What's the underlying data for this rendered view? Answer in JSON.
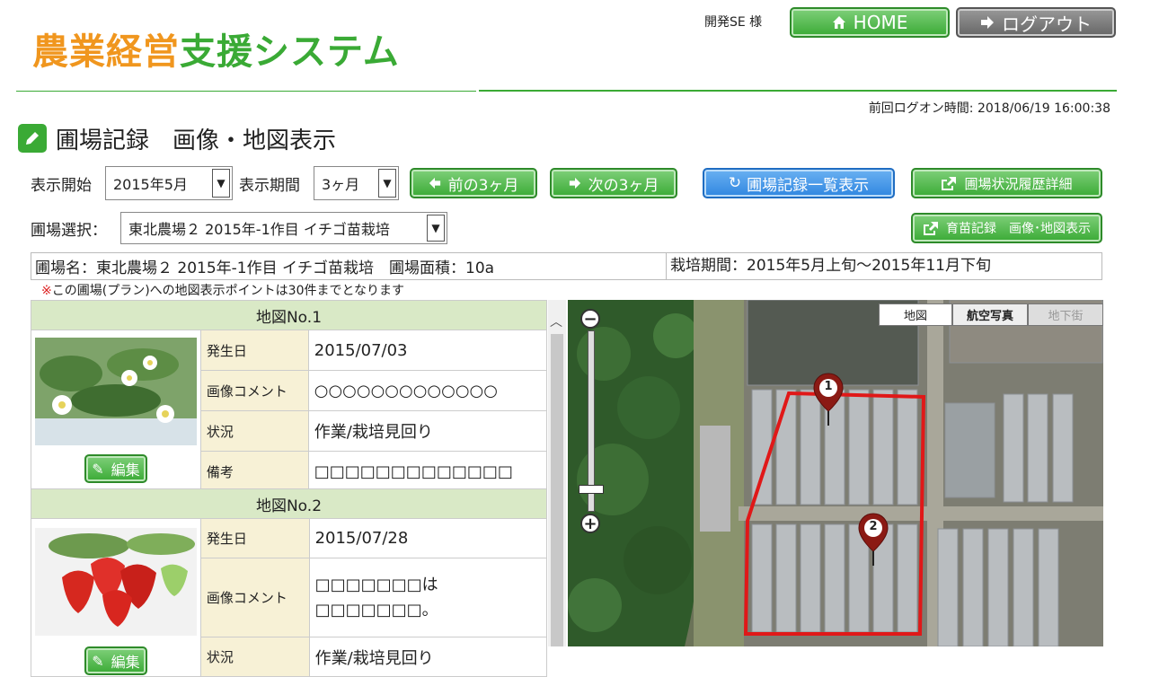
{
  "header": {
    "logo_part1": "農業経営",
    "logo_part2": "支援システム",
    "user_label": "開発SE 様",
    "home_label": "HOME",
    "logout_label": "ログアウト",
    "last_logon": "前回ログオン時間: 2018/06/19 16:00:38"
  },
  "page_title": "圃場記録　画像・地図表示",
  "controls": {
    "start_label": "表示開始",
    "start_value": "2015年5月",
    "period_label": "表示期間",
    "period_value": "3ヶ月",
    "prev_label": "前の3ヶ月",
    "next_label": "次の3ヶ月",
    "list_label": "圃場記録一覧表示",
    "history_label": "圃場状況履歴詳細",
    "field_label": "圃場選択：",
    "field_value": "東北農場２ 2015年-1作目 イチゴ苗栽培",
    "seedling_label": "育苗記録　画像･地図表示"
  },
  "info": {
    "field_name": "圃場名：東北農場２ 2015年-1作目 イチゴ苗栽培　圃場面積：10a",
    "period": "栽培期間：2015年5月上旬～2015年11月下旬"
  },
  "note": {
    "mark": "※",
    "text": "この圃場(プラン)への地図表示ポイントは30件までとなります"
  },
  "records": [
    {
      "header": "地図No.1",
      "edit_label": "編集",
      "rows": [
        {
          "label": "発生日",
          "value": "2015/07/03"
        },
        {
          "label": "画像コメント",
          "value": "○○○○○○○○○○○○○"
        },
        {
          "label": "状況",
          "value": "作業/栽培見回り"
        },
        {
          "label": "備考",
          "value": "□□□□□□□□□□□□□"
        }
      ]
    },
    {
      "header": "地図No.2",
      "edit_label": "編集",
      "rows": [
        {
          "label": "発生日",
          "value": "2015/07/28"
        },
        {
          "label": "画像コメント",
          "value": "□□□□□□□は□□□□□□□。"
        },
        {
          "label": "状況",
          "value": "作業/栽培見回り"
        }
      ]
    }
  ],
  "map": {
    "tab_map": "地図",
    "tab_aerial": "航空写真",
    "tab_underground": "地下街",
    "zoom_in": "+",
    "zoom_out": "−",
    "marker1": "1",
    "marker2": "2"
  },
  "colors": {
    "green": "#3aaa35",
    "orange": "#f0961e",
    "blue": "#2f86e0",
    "field_outline": "#e01818"
  }
}
